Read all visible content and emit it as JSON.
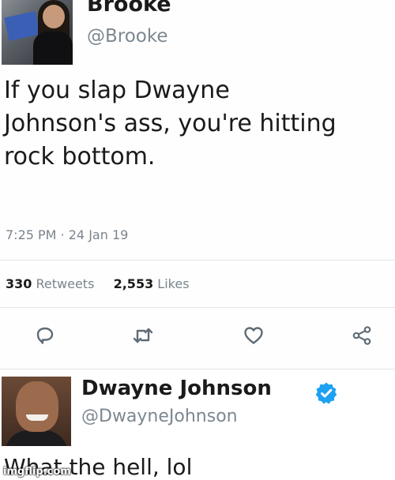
{
  "tweet": {
    "author_name": "Brooke",
    "author_handle": "@Brooke",
    "text": "If you slap Dwayne\nJohnson's ass, you're hitting\nrock bottom.",
    "time": "7:25 PM",
    "separator": "·",
    "date": "24 Jan 19",
    "retweets_count": "330",
    "retweets_label": "Retweets",
    "likes_count": "2,553",
    "likes_label": "Likes",
    "actions": [
      "reply-icon",
      "retweet-icon",
      "like-icon",
      "share-icon"
    ],
    "icon_color": "#5f6b74"
  },
  "reply": {
    "author_name": "Dwayne Johnson",
    "author_handle": "@DwayneJohnson",
    "verified_icon": "verified-badge-icon",
    "verified_color": "#1da1f2",
    "text": "What the hell, lol"
  },
  "watermark": "imgflip.com"
}
